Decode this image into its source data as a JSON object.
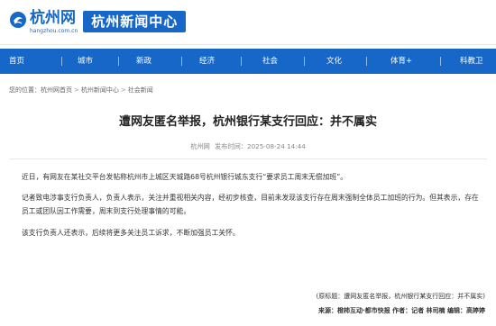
{
  "header": {
    "logo_text": "杭州网",
    "logo_domain": "hangzhou.com.cn",
    "section_title": "杭州新闻中心"
  },
  "nav": {
    "items": [
      {
        "label": "首页"
      },
      {
        "label": "城市"
      },
      {
        "label": "新政"
      },
      {
        "label": "经济"
      },
      {
        "label": "社会"
      },
      {
        "label": "文化"
      },
      {
        "label": "体育+"
      },
      {
        "label": "科教卫"
      }
    ]
  },
  "breadcrumb": {
    "prefix": "您的位置：",
    "items": [
      "杭州网首页",
      "杭州新闻中心",
      "社会新闻"
    ],
    "separator": ">"
  },
  "article": {
    "title": "遭网友匿名举报，杭州银行某支行回应：并不属实",
    "source": "杭州网",
    "published_label": "发布时间：",
    "published_time": "2025-08-24 14:44",
    "paragraphs": [
      "近日，有网友在某社交平台发帖称杭州市上城区天城路68号杭州银行城东支行“要求员工周末无偿加班”。",
      "记者致电涉事支行负责人，负责人表示，关注并重视相关内容，经初步核查，目前未发现该支行存在周末强制全体员工加班的行为。但其表示，存在员工或团队因工作需要，周末到支行处理事情的可能。",
      "该支行负责人还表示，后续将更多关注员工诉求，不断加强员工关怀。"
    ],
    "source_note": "(原标题：遭网友匿名举报，杭州银行某支行回应：并不属实)",
    "credit_label": "来源：",
    "credit_source": "橙柿互动·都市快报",
    "author_label": "作者：",
    "author": "记者 林司楠",
    "editor_label": "编辑：",
    "editor": "高婷婷"
  },
  "colors": {
    "brand_blue": "#1767c8",
    "title_text": "#222222",
    "body_text": "#333333",
    "meta_text": "#888888"
  }
}
